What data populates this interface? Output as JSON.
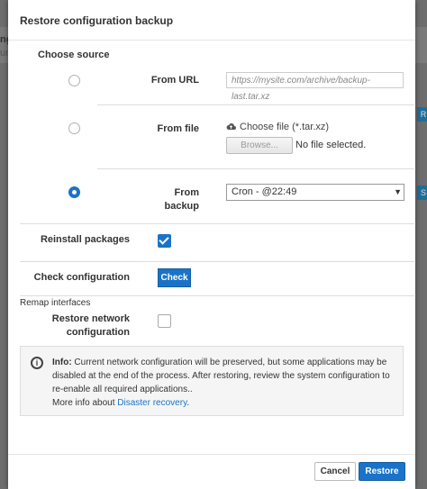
{
  "background": {
    "left_fragments": [
      "ng",
      "ur"
    ],
    "right_buttons": [
      "R",
      "S"
    ]
  },
  "modal": {
    "title": "Restore configuration backup",
    "choose_source_label": "Choose source",
    "from_url": {
      "label": "From URL",
      "placeholder": "https://mysite.com/archive/backup-last.tar.xz",
      "selected": false
    },
    "from_file": {
      "label": "From file",
      "choose_text": "Choose file (*.tar.xz)",
      "browse_label": "Browse...",
      "no_file_text": "No file selected.",
      "selected": false
    },
    "from_backup": {
      "label_line1": "From",
      "label_line2": "backup",
      "selected_value": "Cron - @22:49",
      "selected": true
    },
    "reinstall_packages": {
      "label": "Reinstall packages",
      "checked": true
    },
    "check_configuration": {
      "label": "Check configuration",
      "button_label": "Check"
    },
    "remap_interfaces_label": "Remap interfaces",
    "restore_network": {
      "label_line1": "Restore network",
      "label_line2": "configuration",
      "checked": false
    },
    "info": {
      "bold": "Info:",
      "text": " Current network configuration will be preserved, but some applications may be disabled at the end of the process. After restoring, review the system configuration to re-enable all required applications..",
      "more_prefix": "More info about ",
      "link_text": "Disaster recovery",
      "more_suffix": "."
    },
    "cancel_label": "Cancel",
    "restore_label": "Restore"
  },
  "colors": {
    "accent": "#1a73c8",
    "overlay": "#6f6f6f"
  }
}
